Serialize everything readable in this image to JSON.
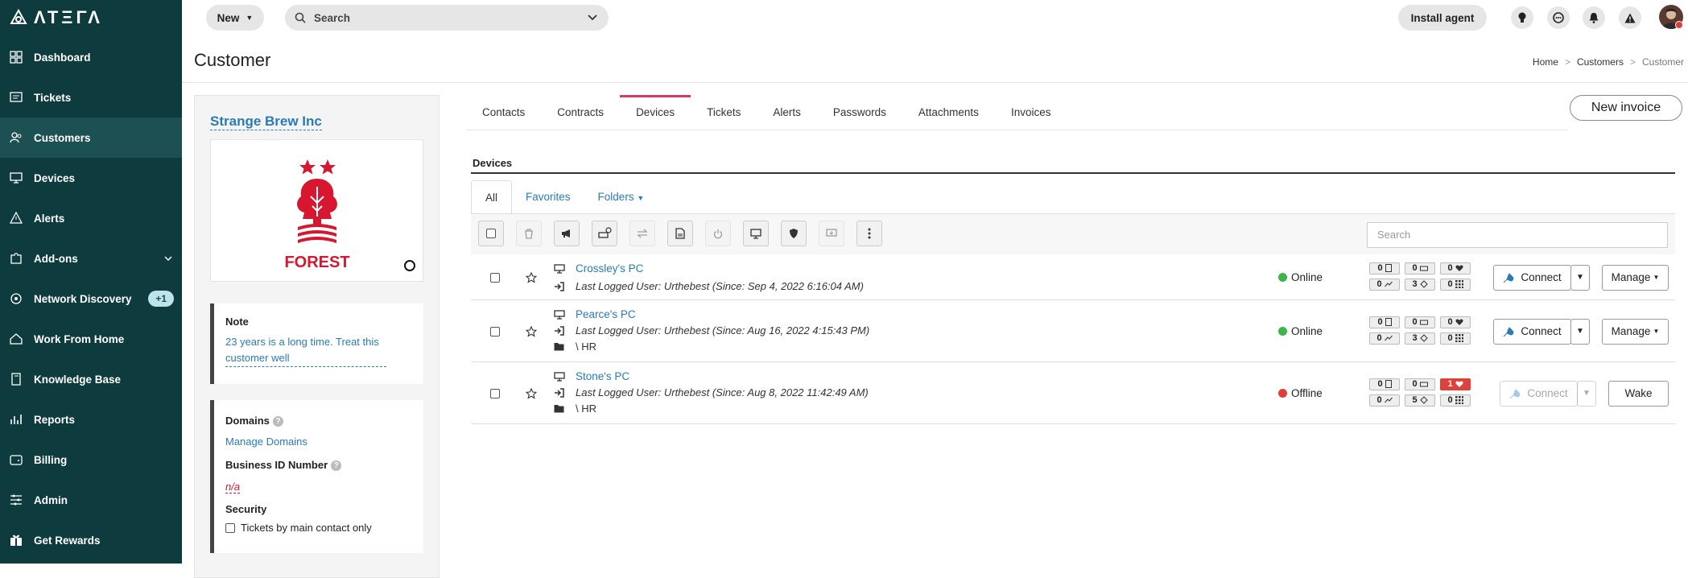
{
  "app": {
    "logo_text": "ΛΤΞΓΛ"
  },
  "sidebar": {
    "items": [
      {
        "label": "Dashboard",
        "icon": "dashboard-icon"
      },
      {
        "label": "Tickets",
        "icon": "ticket-icon"
      },
      {
        "label": "Customers",
        "icon": "customers-icon",
        "active": true
      },
      {
        "label": "Devices",
        "icon": "monitor-icon"
      },
      {
        "label": "Alerts",
        "icon": "warning-icon"
      },
      {
        "label": "Add-ons",
        "icon": "puzzle-icon"
      },
      {
        "label": "Network Discovery",
        "icon": "network-icon",
        "badge": "+1"
      },
      {
        "label": "Work From Home",
        "icon": "home-icon"
      },
      {
        "label": "Knowledge Base",
        "icon": "book-icon"
      },
      {
        "label": "Reports",
        "icon": "chart-icon"
      },
      {
        "label": "Billing",
        "icon": "wallet-icon"
      },
      {
        "label": "Admin",
        "icon": "sliders-icon"
      },
      {
        "label": "Get Rewards",
        "icon": "gift-icon"
      }
    ]
  },
  "topbar": {
    "new_label": "New",
    "search_placeholder": "Search",
    "install_label": "Install agent"
  },
  "page": {
    "title": "Customer",
    "breadcrumb": [
      "Home",
      "Customers",
      "Customer"
    ]
  },
  "customer": {
    "name": "Strange Brew Inc",
    "logo_text": "FOREST",
    "note_title": "Note",
    "note_text": "23 years is a long time. Treat this customer well",
    "domains_label": "Domains",
    "domains_link": "Manage Domains",
    "business_id_label": "Business ID Number",
    "business_id_value": "n/a",
    "security_label": "Security",
    "security_option": "Tickets by main contact only"
  },
  "tabs": [
    "Contacts",
    "Contracts",
    "Devices",
    "Tickets",
    "Alerts",
    "Passwords",
    "Attachments",
    "Invoices"
  ],
  "active_tab": "Devices",
  "new_invoice_label": "New invoice",
  "devices": {
    "section_title": "Devices",
    "subtabs": [
      "All",
      "Favorites",
      "Folders"
    ],
    "search_placeholder": "Search",
    "rows": [
      {
        "name": "Crossley's PC",
        "user": "Last Logged User: Urthebest (Since: Sep 4, 2022 6:16:04 AM)",
        "folder": "",
        "status": "Online",
        "status_color": "#3cb54a",
        "m": [
          "0",
          "0",
          "0",
          "0",
          "3",
          "0"
        ],
        "alert": false,
        "connect": "Connect",
        "action": "Manage"
      },
      {
        "name": "Pearce's PC",
        "user": "Last Logged User: Urthebest (Since: Aug 16, 2022 4:15:43 PM)",
        "folder": "\\ HR",
        "status": "Online",
        "status_color": "#3cb54a",
        "m": [
          "0",
          "0",
          "0",
          "0",
          "3",
          "0"
        ],
        "alert": false,
        "connect": "Connect",
        "action": "Manage"
      },
      {
        "name": "Stone's PC",
        "user": "Last Logged User: Urthebest (Since: Aug 8, 2022 11:42:49 AM)",
        "folder": "\\ HR",
        "status": "Offline",
        "status_color": "#e0403a",
        "m": [
          "0",
          "0",
          "1",
          "0",
          "5",
          "0"
        ],
        "alert": true,
        "connect": "Connect",
        "action": "Wake"
      }
    ]
  },
  "colors": {
    "sidebar": "#0e3b3d",
    "accent": "#e2365a",
    "link": "#2a7ab9"
  }
}
